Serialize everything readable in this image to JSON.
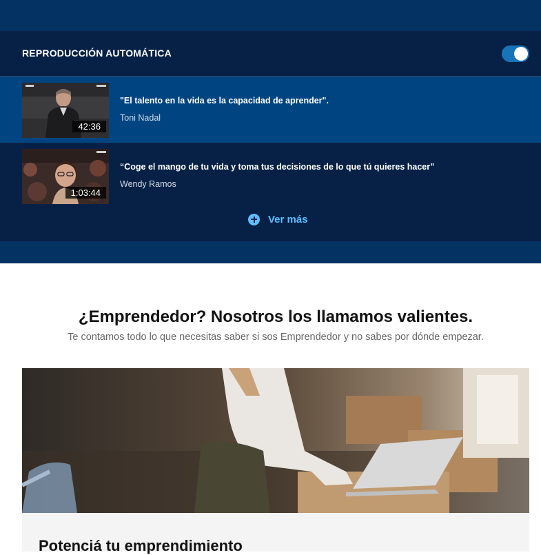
{
  "autoplay": {
    "title": "REPRODUCCIÓN AUTOMÁTICA",
    "enabled": true
  },
  "videos": [
    {
      "title": "\"El talento en la vida es la capacidad de aprender\".",
      "author": "Toni Nadal",
      "duration": "42:36",
      "active": true
    },
    {
      "title": "“Coge el mango de tu vida y toma tus decisiones de lo que tú quieres hacer”",
      "author": "Wendy Ramos",
      "duration": "1:03:44",
      "active": false
    }
  ],
  "see_more": {
    "label": "Ver más",
    "icon": "plus-circle-icon"
  },
  "promo": {
    "heading": "¿Emprendedor? Nosotros los llamamos valientes.",
    "subheading": "Te contamos todo lo que necesitas saber si sos Emprendedor y no sabes por dónde empezar.",
    "card_title": "Potenciá tu emprendimiento"
  },
  "colors": {
    "panel": "#072146",
    "band": "#043263",
    "active_row": "#004481",
    "accent": "#5bbeff",
    "toggle": "#1973b8"
  }
}
